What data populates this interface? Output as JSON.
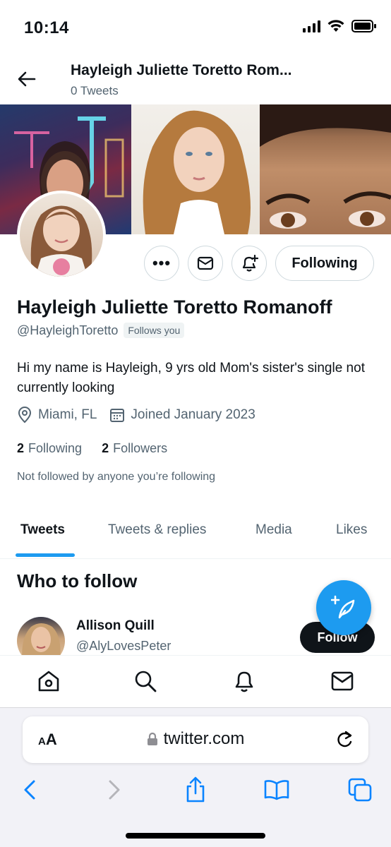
{
  "status_bar": {
    "time": "10:14"
  },
  "header": {
    "name": "Hayleigh Juliette Toretto Rom...",
    "tweet_count": "0 Tweets"
  },
  "profile": {
    "name": "Hayleigh Juliette Toretto Romanoff",
    "handle": "@HayleighToretto",
    "follows_you": "Follows you",
    "bio": "Hi my name is Hayleigh, 9 yrs old Mom's sister's single not currently looking",
    "location": "Miami, FL",
    "joined": "Joined January 2023",
    "following_count": "2",
    "following_label": "Following",
    "followers_count": "2",
    "followers_label": "Followers",
    "not_followed": "Not followed by anyone you’re following"
  },
  "actions": {
    "more_label": "•••",
    "following_button": "Following"
  },
  "tabs": [
    {
      "label": "Tweets",
      "active": true
    },
    {
      "label": "Tweets & replies",
      "active": false
    },
    {
      "label": "Media",
      "active": false
    },
    {
      "label": "Likes",
      "active": false
    }
  ],
  "who_to_follow": {
    "title": "Who to follow",
    "suggestions": [
      {
        "name": "Allison Quill",
        "handle": "@AlyLovesPeter",
        "button": "Follow"
      }
    ]
  },
  "bottom_nav": [
    "home-icon",
    "search-icon",
    "bell-icon",
    "mail-icon"
  ],
  "browser": {
    "aa_big": "A",
    "aa_small": "A",
    "url": "twitter.com",
    "toolbar": [
      "back-icon",
      "forward-icon",
      "share-icon",
      "bookmarks-icon",
      "tabs-icon"
    ]
  },
  "colors": {
    "accent": "#1d9bf0",
    "text": "#0f1419",
    "secondary": "#536471",
    "ios_blue": "#0a84ff"
  }
}
